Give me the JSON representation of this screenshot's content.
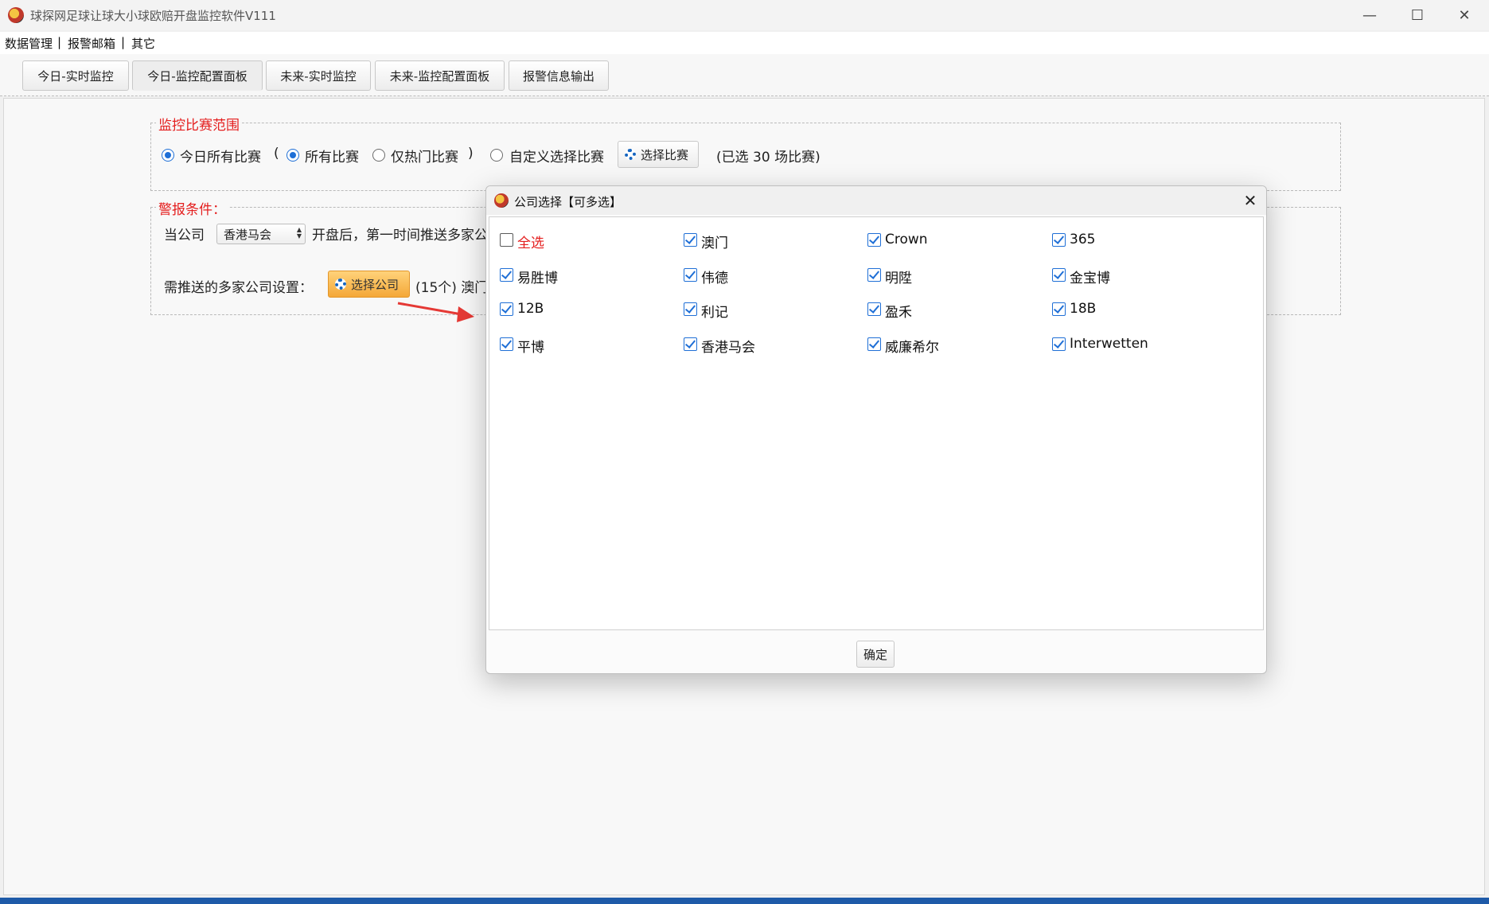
{
  "window": {
    "title": "球探网足球让球大小球欧赔开盘监控软件V111",
    "min_glyph": "—",
    "max_glyph": "☐",
    "close_glyph": "✕"
  },
  "menu": {
    "items": [
      "数据管理",
      "报警邮箱",
      "其它"
    ],
    "separator": "|"
  },
  "tabs": [
    "今日-实时监控",
    "今日-监控配置面板",
    "未来-实时监控",
    "未来-监控配置面板",
    "报警信息输出"
  ],
  "active_tab": "今日-监控配置面板",
  "scope": {
    "title": "监控比赛范围",
    "today_all": "今日所有比赛",
    "paren_open": "(",
    "all_matches": "所有比赛",
    "hot_only": "仅热门比赛",
    "paren_close": ")",
    "custom": "自定义选择比赛",
    "select_button": "选择比赛",
    "selected_summary": "(已选  30  场比赛)"
  },
  "alarm": {
    "title": "警报条件：",
    "when_company": "当公司",
    "company_value": "香港马会",
    "after_open": "开盘后，第一时间推送多家公",
    "push_label": "需推送的多家公司设置：",
    "select_company_button": "选择公司",
    "selected_companies": "(15个) 澳门"
  },
  "dialog": {
    "title": "公司选择【可多选】",
    "close_glyph": "✕",
    "select_all": "全选",
    "ok_button": "确定",
    "companies": [
      {
        "name": "澳门",
        "checked": true
      },
      {
        "name": "Crown",
        "checked": true
      },
      {
        "name": "365",
        "checked": true
      },
      {
        "name": "易胜博",
        "checked": true
      },
      {
        "name": "伟德",
        "checked": true
      },
      {
        "name": "明陞",
        "checked": true
      },
      {
        "name": "金宝博",
        "checked": true
      },
      {
        "name": "12B",
        "checked": true
      },
      {
        "name": "利记",
        "checked": true
      },
      {
        "name": "盈禾",
        "checked": true
      },
      {
        "name": "18B",
        "checked": true
      },
      {
        "name": "平博",
        "checked": true
      },
      {
        "name": "香港马会",
        "checked": true
      },
      {
        "name": "威廉希尔",
        "checked": true
      },
      {
        "name": "Interwetten",
        "checked": true
      }
    ]
  },
  "colors": {
    "accent_blue": "#1f6fd6",
    "alert_red": "#e41e1e",
    "orange_button": "#f4a838"
  }
}
